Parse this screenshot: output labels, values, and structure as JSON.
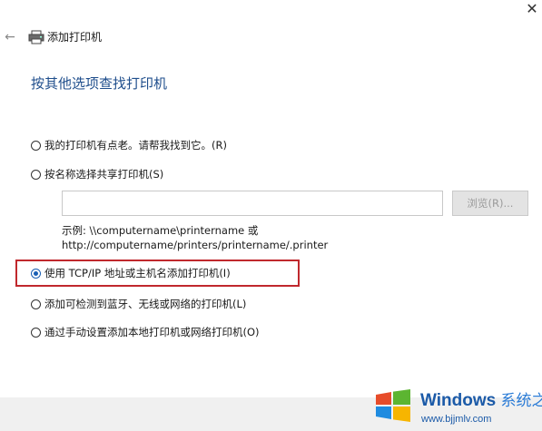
{
  "window": {
    "title": "添加打印机",
    "close_icon": "close-icon",
    "back_icon": "back-arrow-icon",
    "title_icon": "printer-icon"
  },
  "heading": "按其他选项查找打印机",
  "options": [
    {
      "label": "我的打印机有点老。请帮我找到它。(R)",
      "checked": false
    },
    {
      "label": "按名称选择共享打印机(S)",
      "checked": false
    },
    {
      "label": "使用 TCP/IP 地址或主机名添加打印机(I)",
      "checked": true
    },
    {
      "label": "添加可检测到蓝牙、无线或网络的打印机(L)",
      "checked": false
    },
    {
      "label": "通过手动设置添加本地打印机或网络打印机(O)",
      "checked": false
    }
  ],
  "share_input": {
    "value": "",
    "placeholder": ""
  },
  "browse_button": "浏览(R)...",
  "example": {
    "line1": "示例: \\\\computername\\printername 或",
    "line2": "http://computername/printers/printername/.printer"
  },
  "watermark": {
    "brand": "Windows",
    "brand_cn": "系统之家",
    "url": "www.bjjmlv.com"
  },
  "colors": {
    "heading": "#1f4e8c",
    "highlight": "#c0282d",
    "radio_checked": "#1a5fb4",
    "brand": "#1b5aa8"
  }
}
